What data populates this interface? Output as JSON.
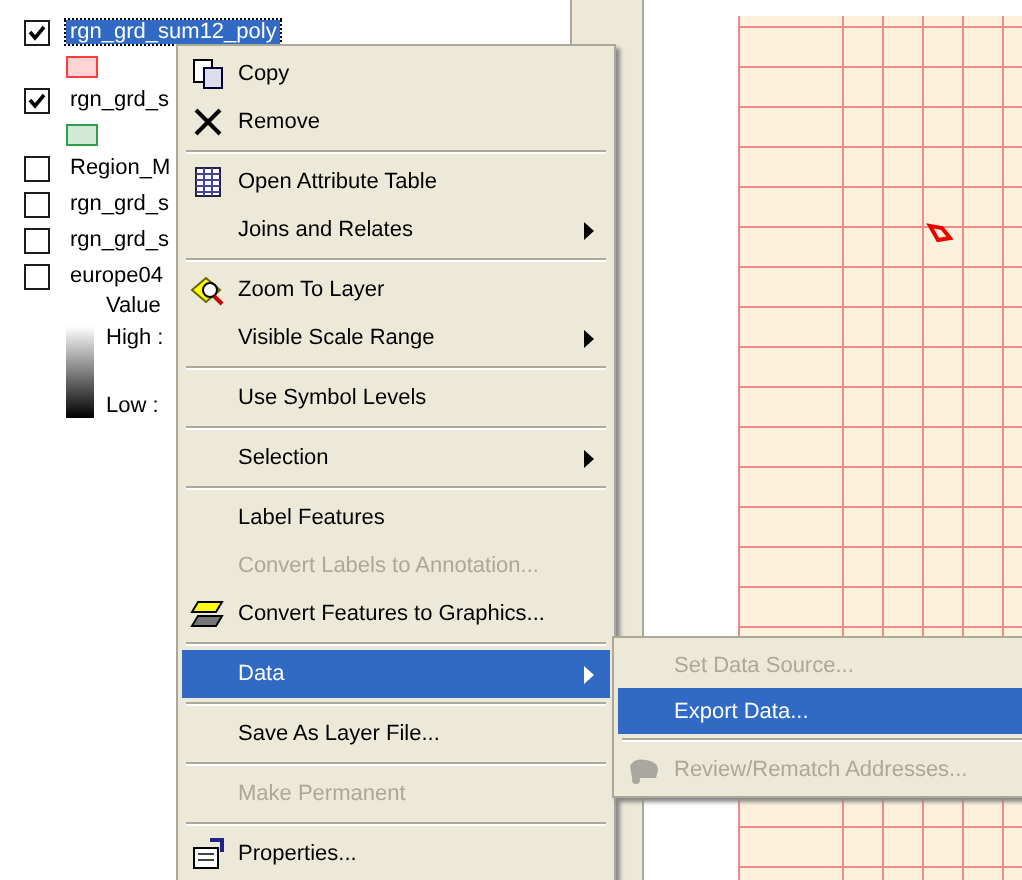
{
  "toc": {
    "layers": [
      {
        "name": "rgn_grd_sum12_poly",
        "checked": true,
        "selected": true,
        "symbol": {
          "color": "#ff3b3b"
        }
      },
      {
        "name": "rgn_grd_s",
        "checked": true,
        "selected": false,
        "symbol": {
          "color": "#2e9e4a"
        }
      },
      {
        "name": "Region_M",
        "checked": false,
        "selected": false
      },
      {
        "name": "rgn_grd_s",
        "checked": false,
        "selected": false
      },
      {
        "name": "rgn_grd_s",
        "checked": false,
        "selected": false
      },
      {
        "name": "europe04",
        "checked": false,
        "selected": false,
        "legend": {
          "title": "Value",
          "high": "High :",
          "low": "Low :"
        }
      }
    ]
  },
  "context_menu": {
    "items": [
      {
        "kind": "item",
        "label": "Copy",
        "disabled": false,
        "selected": false,
        "submenu": false
      },
      {
        "kind": "item",
        "label": "Remove",
        "disabled": false,
        "selected": false,
        "submenu": false
      },
      {
        "kind": "separator"
      },
      {
        "kind": "item",
        "label": "Open Attribute Table",
        "disabled": false,
        "selected": false,
        "submenu": false
      },
      {
        "kind": "item",
        "label": "Joins and Relates",
        "disabled": false,
        "selected": false,
        "submenu": true
      },
      {
        "kind": "separator"
      },
      {
        "kind": "item",
        "label": "Zoom To Layer",
        "disabled": false,
        "selected": false,
        "submenu": false
      },
      {
        "kind": "item",
        "label": "Visible Scale Range",
        "disabled": false,
        "selected": false,
        "submenu": true
      },
      {
        "kind": "separator"
      },
      {
        "kind": "item",
        "label": "Use Symbol Levels",
        "disabled": false,
        "selected": false,
        "submenu": false
      },
      {
        "kind": "separator"
      },
      {
        "kind": "item",
        "label": "Selection",
        "disabled": false,
        "selected": false,
        "submenu": true
      },
      {
        "kind": "separator"
      },
      {
        "kind": "item",
        "label": "Label Features",
        "disabled": false,
        "selected": false,
        "submenu": false
      },
      {
        "kind": "item",
        "label": "Convert Labels to Annotation...",
        "disabled": true,
        "selected": false,
        "submenu": false
      },
      {
        "kind": "item",
        "label": "Convert Features to Graphics...",
        "disabled": false,
        "selected": false,
        "submenu": false
      },
      {
        "kind": "separator"
      },
      {
        "kind": "item",
        "label": "Data",
        "disabled": false,
        "selected": true,
        "submenu": true
      },
      {
        "kind": "separator"
      },
      {
        "kind": "item",
        "label": "Save As Layer File...",
        "disabled": false,
        "selected": false,
        "submenu": false
      },
      {
        "kind": "separator"
      },
      {
        "kind": "item",
        "label": "Make Permanent",
        "disabled": true,
        "selected": false,
        "submenu": false
      },
      {
        "kind": "separator"
      },
      {
        "kind": "item",
        "label": "Properties...",
        "disabled": false,
        "selected": false,
        "submenu": false
      }
    ]
  },
  "submenu": {
    "items": [
      {
        "kind": "item",
        "label": "Set Data Source...",
        "disabled": true,
        "selected": false
      },
      {
        "kind": "item",
        "label": "Export Data...",
        "disabled": false,
        "selected": true
      },
      {
        "kind": "separator"
      },
      {
        "kind": "item",
        "label": "Review/Rematch Addresses...",
        "disabled": true,
        "selected": false
      }
    ]
  }
}
